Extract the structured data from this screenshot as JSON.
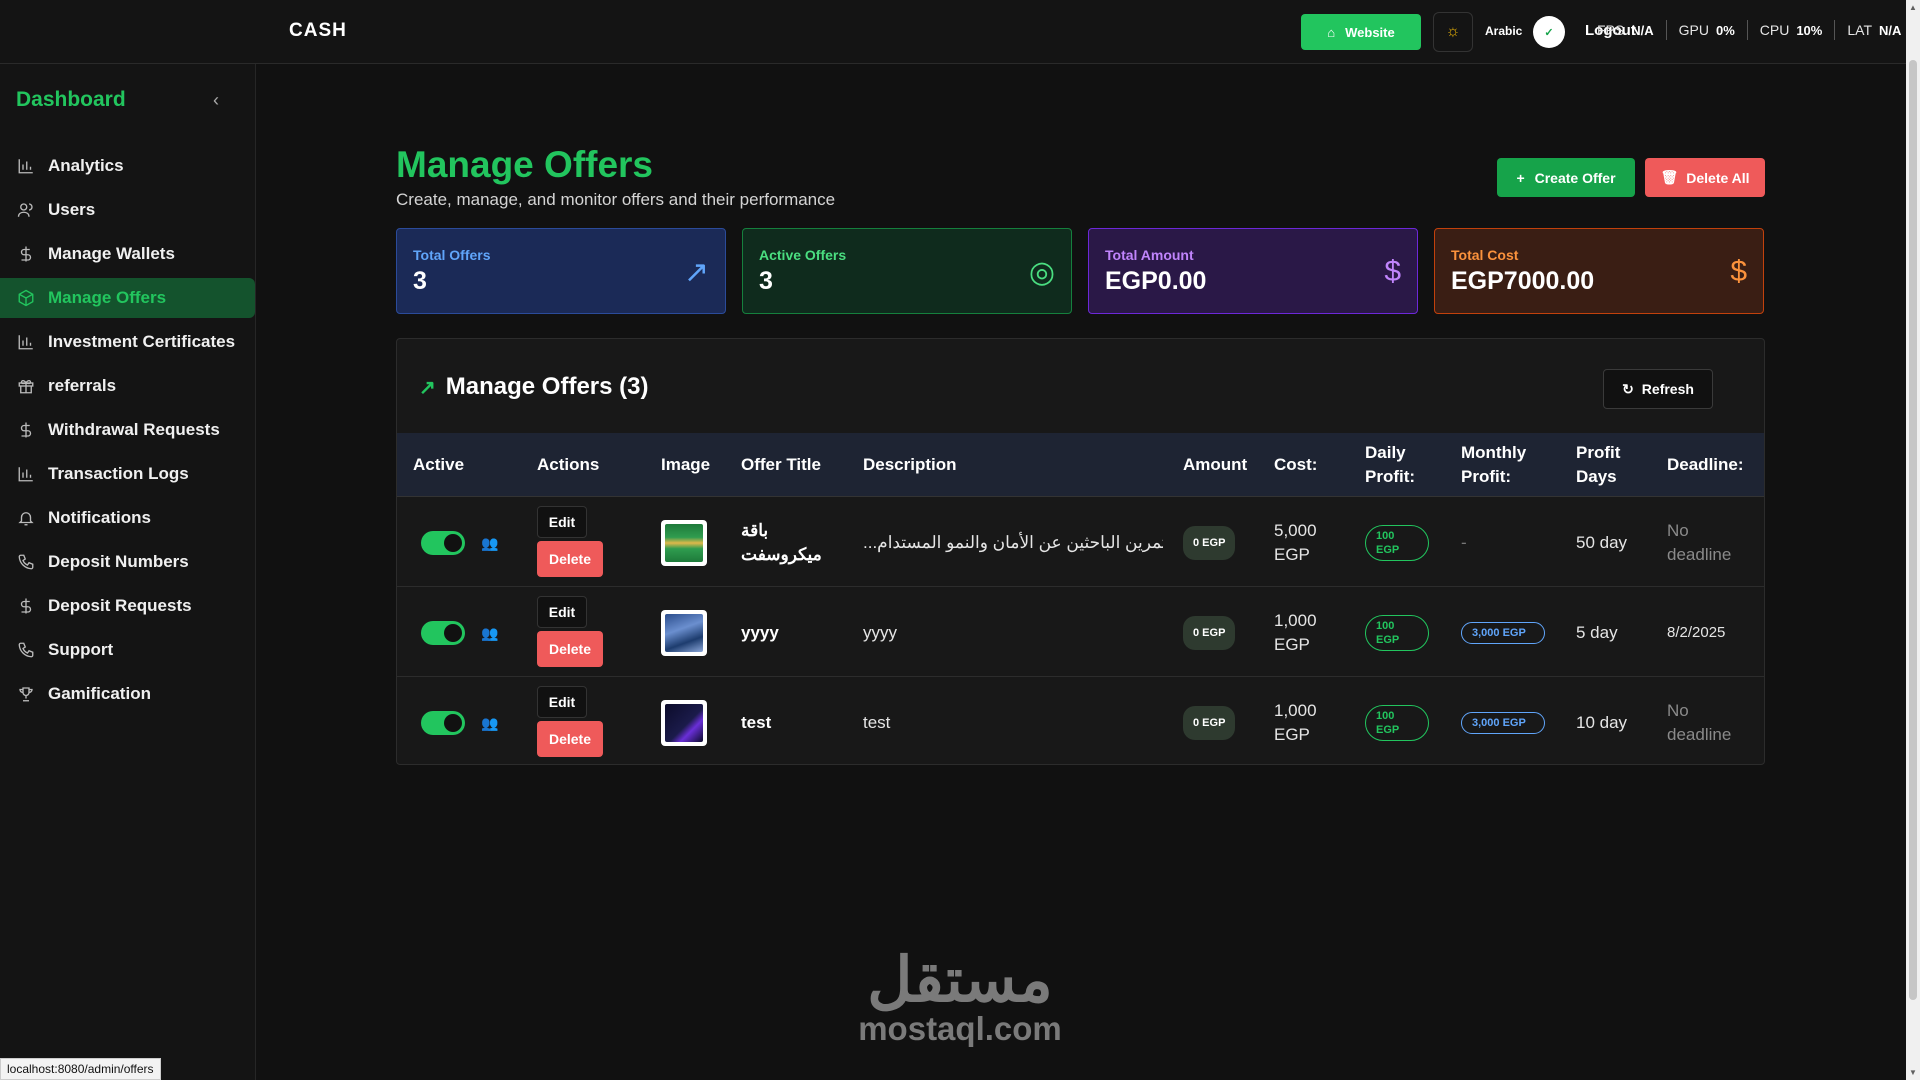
{
  "topbar": {
    "logo": "CASH",
    "website_label": "Website",
    "language": "Arabic",
    "avatar_text": "✓",
    "logout_label": "Logout",
    "stats": [
      {
        "label": "FPS",
        "value": "N/A"
      },
      {
        "label": "GPU",
        "value": "0%"
      },
      {
        "label": "CPU",
        "value": "10%"
      },
      {
        "label": "LAT",
        "value": "N/A"
      }
    ]
  },
  "sidebar": {
    "title": "Dashboard",
    "items": [
      {
        "label": "Analytics",
        "icon": "bar-chart-icon"
      },
      {
        "label": "Users",
        "icon": "users-icon"
      },
      {
        "label": "Manage Wallets",
        "icon": "dollar-icon"
      },
      {
        "label": "Manage Offers",
        "icon": "package-icon",
        "active": true
      },
      {
        "label": "Investment Certificates",
        "icon": "bar-chart-icon"
      },
      {
        "label": "referrals",
        "icon": "gift-icon"
      },
      {
        "label": "Withdrawal Requests",
        "icon": "dollar-icon"
      },
      {
        "label": "Transaction Logs",
        "icon": "bar-chart-icon"
      },
      {
        "label": "Notifications",
        "icon": "bell-icon"
      },
      {
        "label": "Deposit Numbers",
        "icon": "phone-icon"
      },
      {
        "label": "Deposit Requests",
        "icon": "dollar-icon"
      },
      {
        "label": "Support",
        "icon": "phone-icon"
      },
      {
        "label": "Gamification",
        "icon": "trophy-icon"
      }
    ]
  },
  "header": {
    "title": "Manage Offers",
    "subtitle": "Create, manage, and monitor offers and their performance",
    "create_label": "Create Offer",
    "delete_all_label": "Delete All"
  },
  "cards": [
    {
      "label": "Total Offers",
      "value": "3",
      "icon": "trending-up-icon",
      "color": "#60a5fa"
    },
    {
      "label": "Active Offers",
      "value": "3",
      "icon": "target-icon",
      "color": "#4ade80"
    },
    {
      "label": "Total Amount",
      "value": "EGP0.00",
      "icon": "dollar-icon",
      "color": "#c084fc"
    },
    {
      "label": "Total Cost",
      "value": "EGP7000.00",
      "icon": "dollar-icon",
      "color": "#fb923c"
    }
  ],
  "table": {
    "title": "Manage Offers (3)",
    "refresh_label": "Refresh",
    "columns": [
      "Active",
      "Actions",
      "Image",
      "Offer Title",
      "Description",
      "Amount",
      "Cost:",
      "Daily Profit:",
      "Monthly Profit:",
      "Profit Days",
      "Deadline:"
    ],
    "edit_label": "Edit",
    "delete_label": "Delete",
    "rows": [
      {
        "active": true,
        "title": "باقة ميكروسفت",
        "description": "...ثمرين الباحثين عن الأمان والنمو المستدام",
        "amount": "0 EGP",
        "cost": "5,000 EGP",
        "daily": "100 EGP",
        "monthly": "-",
        "days": "50 day",
        "deadline": "No deadline"
      },
      {
        "active": true,
        "title": "yyyy",
        "description": "yyyy",
        "amount": "0 EGP",
        "cost": "1,000 EGP",
        "daily": "100 EGP",
        "monthly": "3,000 EGP",
        "days": "5 day",
        "deadline": "8/2/2025"
      },
      {
        "active": true,
        "title": "test",
        "description": "test",
        "amount": "0 EGP",
        "cost": "1,000 EGP",
        "daily": "100 EGP",
        "monthly": "3,000 EGP",
        "days": "10 day",
        "deadline": "No deadline"
      }
    ]
  },
  "watermark": {
    "arabic": "مستقل",
    "latin": "mostaql.com"
  },
  "statusbar": "localhost:8080/admin/offers"
}
